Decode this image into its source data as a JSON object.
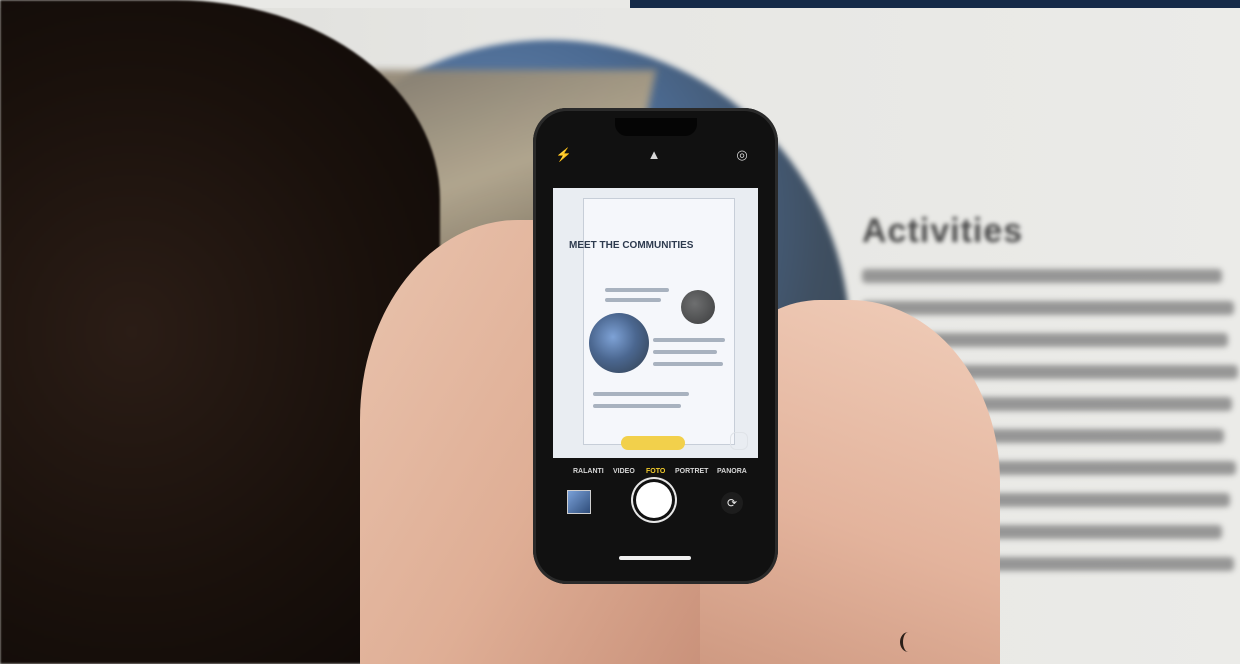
{
  "background_poster": {
    "heading": "Activities"
  },
  "phone_camera": {
    "viewfinder_board": {
      "title": "MEET THE COMMUNITIES",
      "subtitle": "",
      "chip_label": ""
    },
    "modes": [
      "RALANTI",
      "VIDEO",
      "FOTO",
      "PORTRET",
      "PANORA"
    ],
    "active_mode": "FOTO"
  },
  "colors": {
    "top_bar": "#152a48",
    "active_mode": "#f3cc2c"
  }
}
